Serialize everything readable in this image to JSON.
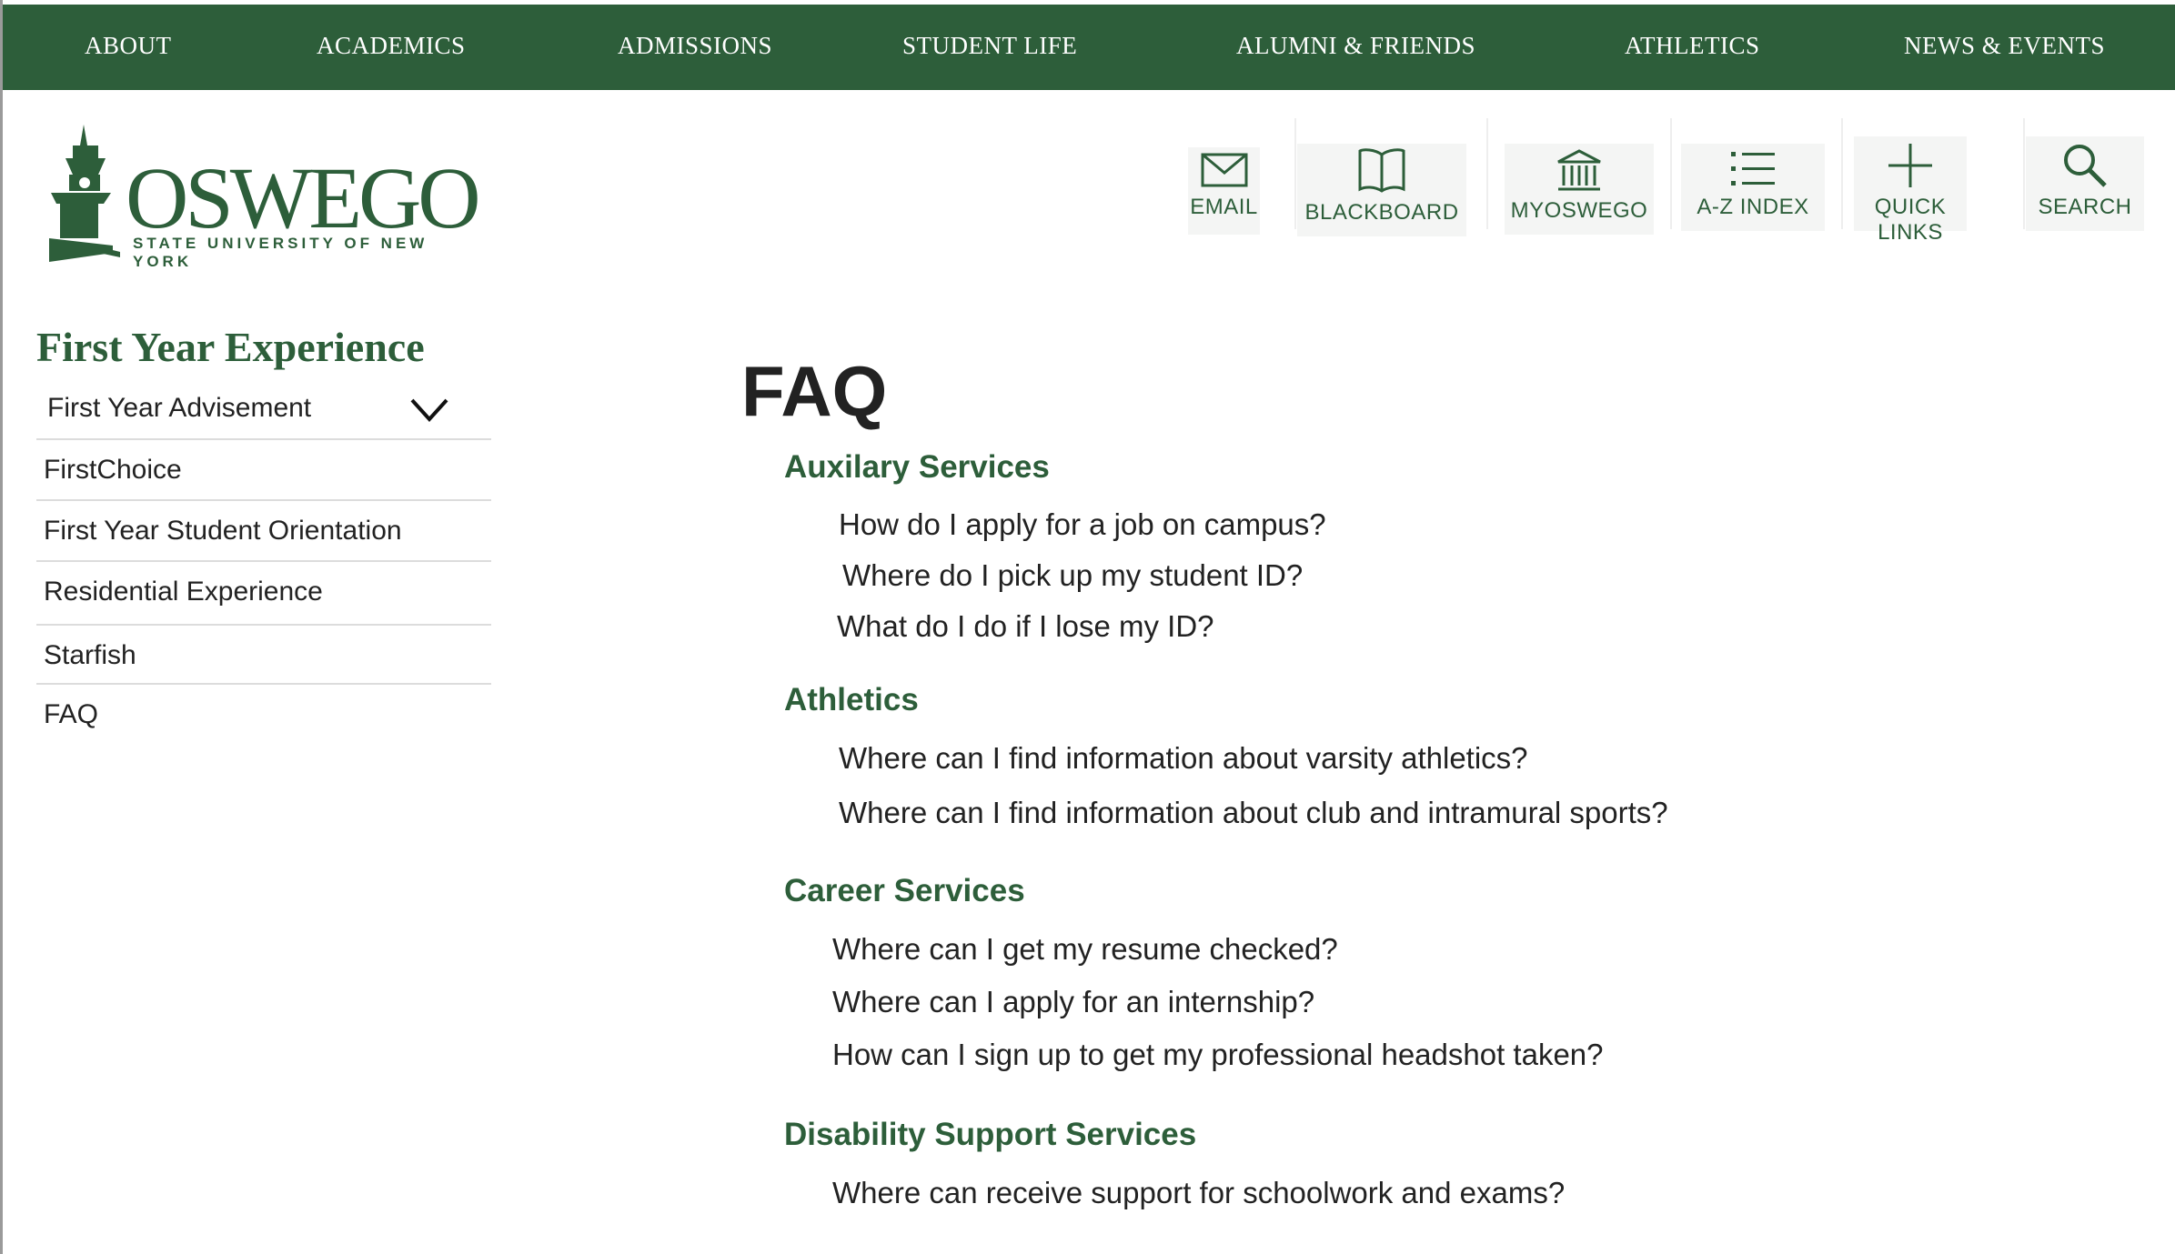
{
  "top_nav": [
    {
      "label": "ABOUT"
    },
    {
      "label": "ACADEMICS"
    },
    {
      "label": "ADMISSIONS"
    },
    {
      "label": "STUDENT LIFE"
    },
    {
      "label": "ALUMNI & FRIENDS"
    },
    {
      "label": "ATHLETICS"
    },
    {
      "label": "NEWS & EVENTS"
    }
  ],
  "logo": {
    "word": "OSWEGO",
    "subtitle": "STATE UNIVERSITY OF NEW YORK"
  },
  "utility_nav": [
    {
      "label": "EMAIL",
      "icon": "envelope-icon"
    },
    {
      "label": "BLACKBOARD",
      "icon": "book-icon"
    },
    {
      "label": "MYOSWEGO",
      "icon": "building-icon"
    },
    {
      "label": "A-Z INDEX",
      "icon": "list-icon"
    },
    {
      "label": "QUICK LINKS",
      "icon": "plus-icon"
    },
    {
      "label": "SEARCH",
      "icon": "search-icon"
    }
  ],
  "sidebar": {
    "title": "First Year Experience",
    "items": [
      {
        "label": "First Year Advisement",
        "expandable": true
      },
      {
        "label": "FirstChoice"
      },
      {
        "label": "First Year Student Orientation"
      },
      {
        "label": "Residential Experience"
      },
      {
        "label": "Starfish"
      },
      {
        "label": "FAQ"
      }
    ]
  },
  "main": {
    "title": "FAQ",
    "sections": [
      {
        "heading": "Auxilary Services",
        "questions": [
          "How do I apply for a job on campus?",
          "Where do I pick up my student ID?",
          "What do I do if I lose my ID?"
        ]
      },
      {
        "heading": "Athletics",
        "questions": [
          "Where can I find information about varsity athletics?",
          "Where can I find information about club and intramural sports?"
        ]
      },
      {
        "heading": "Career Services",
        "questions": [
          "Where can I get my resume checked?",
          "Where can I apply for an internship?",
          "How can I sign up to get my professional headshot taken?"
        ]
      },
      {
        "heading": "Disability Support Services",
        "questions": [
          "Where can receive support for schoolwork and exams?"
        ]
      }
    ]
  },
  "colors": {
    "brand_green": "#2d5e3a",
    "text": "#222222",
    "divider": "#dcdcdc"
  }
}
